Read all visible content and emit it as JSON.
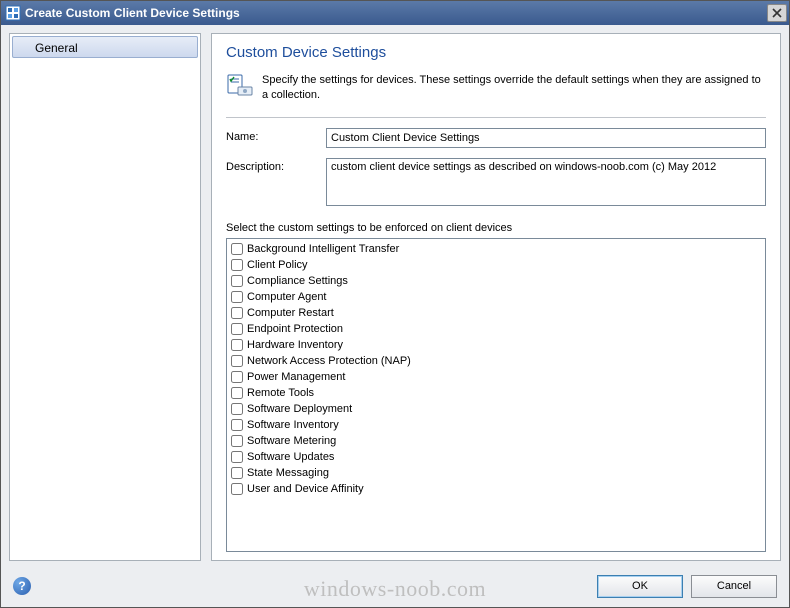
{
  "window": {
    "title": "Create Custom Client Device Settings"
  },
  "sidebar": {
    "items": [
      {
        "label": "General"
      }
    ]
  },
  "panel": {
    "heading": "Custom Device Settings",
    "intro": "Specify the settings for devices. These settings override the default settings when they are assigned to a collection."
  },
  "form": {
    "name_label": "Name:",
    "name_value": "Custom Client Device Settings",
    "description_label": "Description:",
    "description_value": "custom client device settings as described on windows-noob.com (c) May 2012",
    "select_label": "Select the custom settings to be enforced on client devices"
  },
  "checklist": [
    "Background Intelligent Transfer",
    "Client Policy",
    "Compliance Settings",
    "Computer Agent",
    "Computer Restart",
    "Endpoint Protection",
    "Hardware Inventory",
    "Network Access Protection (NAP)",
    "Power Management",
    "Remote Tools",
    "Software Deployment",
    "Software Inventory",
    "Software Metering",
    "Software Updates",
    "State Messaging",
    "User and Device Affinity"
  ],
  "buttons": {
    "ok": "OK",
    "cancel": "Cancel"
  },
  "watermark": "windows-noob.com"
}
